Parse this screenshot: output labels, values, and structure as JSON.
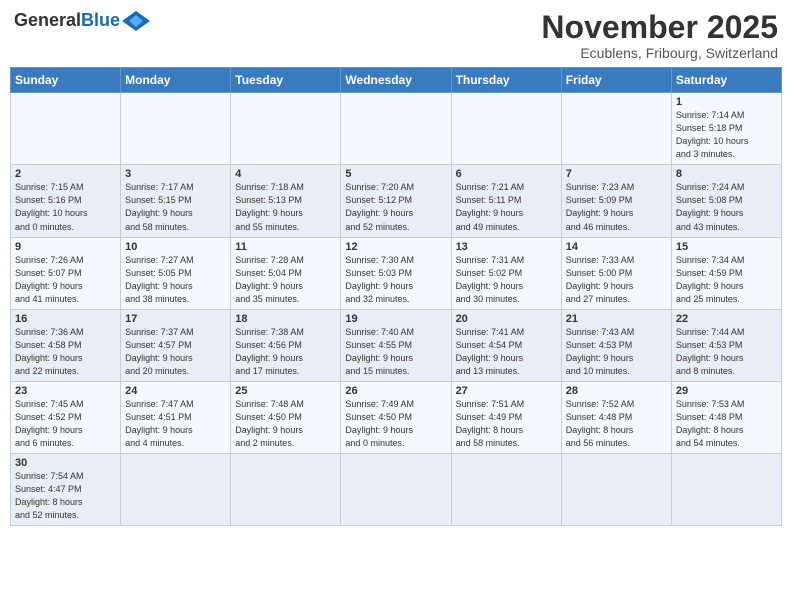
{
  "logo": {
    "general": "General",
    "blue": "Blue"
  },
  "title": "November 2025",
  "location": "Ecublens, Fribourg, Switzerland",
  "days_of_week": [
    "Sunday",
    "Monday",
    "Tuesday",
    "Wednesday",
    "Thursday",
    "Friday",
    "Saturday"
  ],
  "weeks": [
    [
      {
        "day": "",
        "info": ""
      },
      {
        "day": "",
        "info": ""
      },
      {
        "day": "",
        "info": ""
      },
      {
        "day": "",
        "info": ""
      },
      {
        "day": "",
        "info": ""
      },
      {
        "day": "",
        "info": ""
      },
      {
        "day": "1",
        "info": "Sunrise: 7:14 AM\nSunset: 5:18 PM\nDaylight: 10 hours\nand 3 minutes."
      }
    ],
    [
      {
        "day": "2",
        "info": "Sunrise: 7:15 AM\nSunset: 5:16 PM\nDaylight: 10 hours\nand 0 minutes."
      },
      {
        "day": "3",
        "info": "Sunrise: 7:17 AM\nSunset: 5:15 PM\nDaylight: 9 hours\nand 58 minutes."
      },
      {
        "day": "4",
        "info": "Sunrise: 7:18 AM\nSunset: 5:13 PM\nDaylight: 9 hours\nand 55 minutes."
      },
      {
        "day": "5",
        "info": "Sunrise: 7:20 AM\nSunset: 5:12 PM\nDaylight: 9 hours\nand 52 minutes."
      },
      {
        "day": "6",
        "info": "Sunrise: 7:21 AM\nSunset: 5:11 PM\nDaylight: 9 hours\nand 49 minutes."
      },
      {
        "day": "7",
        "info": "Sunrise: 7:23 AM\nSunset: 5:09 PM\nDaylight: 9 hours\nand 46 minutes."
      },
      {
        "day": "8",
        "info": "Sunrise: 7:24 AM\nSunset: 5:08 PM\nDaylight: 9 hours\nand 43 minutes."
      }
    ],
    [
      {
        "day": "9",
        "info": "Sunrise: 7:26 AM\nSunset: 5:07 PM\nDaylight: 9 hours\nand 41 minutes."
      },
      {
        "day": "10",
        "info": "Sunrise: 7:27 AM\nSunset: 5:05 PM\nDaylight: 9 hours\nand 38 minutes."
      },
      {
        "day": "11",
        "info": "Sunrise: 7:28 AM\nSunset: 5:04 PM\nDaylight: 9 hours\nand 35 minutes."
      },
      {
        "day": "12",
        "info": "Sunrise: 7:30 AM\nSunset: 5:03 PM\nDaylight: 9 hours\nand 32 minutes."
      },
      {
        "day": "13",
        "info": "Sunrise: 7:31 AM\nSunset: 5:02 PM\nDaylight: 9 hours\nand 30 minutes."
      },
      {
        "day": "14",
        "info": "Sunrise: 7:33 AM\nSunset: 5:00 PM\nDaylight: 9 hours\nand 27 minutes."
      },
      {
        "day": "15",
        "info": "Sunrise: 7:34 AM\nSunset: 4:59 PM\nDaylight: 9 hours\nand 25 minutes."
      }
    ],
    [
      {
        "day": "16",
        "info": "Sunrise: 7:36 AM\nSunset: 4:58 PM\nDaylight: 9 hours\nand 22 minutes."
      },
      {
        "day": "17",
        "info": "Sunrise: 7:37 AM\nSunset: 4:57 PM\nDaylight: 9 hours\nand 20 minutes."
      },
      {
        "day": "18",
        "info": "Sunrise: 7:38 AM\nSunset: 4:56 PM\nDaylight: 9 hours\nand 17 minutes."
      },
      {
        "day": "19",
        "info": "Sunrise: 7:40 AM\nSunset: 4:55 PM\nDaylight: 9 hours\nand 15 minutes."
      },
      {
        "day": "20",
        "info": "Sunrise: 7:41 AM\nSunset: 4:54 PM\nDaylight: 9 hours\nand 13 minutes."
      },
      {
        "day": "21",
        "info": "Sunrise: 7:43 AM\nSunset: 4:53 PM\nDaylight: 9 hours\nand 10 minutes."
      },
      {
        "day": "22",
        "info": "Sunrise: 7:44 AM\nSunset: 4:53 PM\nDaylight: 9 hours\nand 8 minutes."
      }
    ],
    [
      {
        "day": "23",
        "info": "Sunrise: 7:45 AM\nSunset: 4:52 PM\nDaylight: 9 hours\nand 6 minutes."
      },
      {
        "day": "24",
        "info": "Sunrise: 7:47 AM\nSunset: 4:51 PM\nDaylight: 9 hours\nand 4 minutes."
      },
      {
        "day": "25",
        "info": "Sunrise: 7:48 AM\nSunset: 4:50 PM\nDaylight: 9 hours\nand 2 minutes."
      },
      {
        "day": "26",
        "info": "Sunrise: 7:49 AM\nSunset: 4:50 PM\nDaylight: 9 hours\nand 0 minutes."
      },
      {
        "day": "27",
        "info": "Sunrise: 7:51 AM\nSunset: 4:49 PM\nDaylight: 8 hours\nand 58 minutes."
      },
      {
        "day": "28",
        "info": "Sunrise: 7:52 AM\nSunset: 4:48 PM\nDaylight: 8 hours\nand 56 minutes."
      },
      {
        "day": "29",
        "info": "Sunrise: 7:53 AM\nSunset: 4:48 PM\nDaylight: 8 hours\nand 54 minutes."
      }
    ],
    [
      {
        "day": "30",
        "info": "Sunrise: 7:54 AM\nSunset: 4:47 PM\nDaylight: 8 hours\nand 52 minutes."
      },
      {
        "day": "",
        "info": ""
      },
      {
        "day": "",
        "info": ""
      },
      {
        "day": "",
        "info": ""
      },
      {
        "day": "",
        "info": ""
      },
      {
        "day": "",
        "info": ""
      },
      {
        "day": "",
        "info": ""
      }
    ]
  ]
}
